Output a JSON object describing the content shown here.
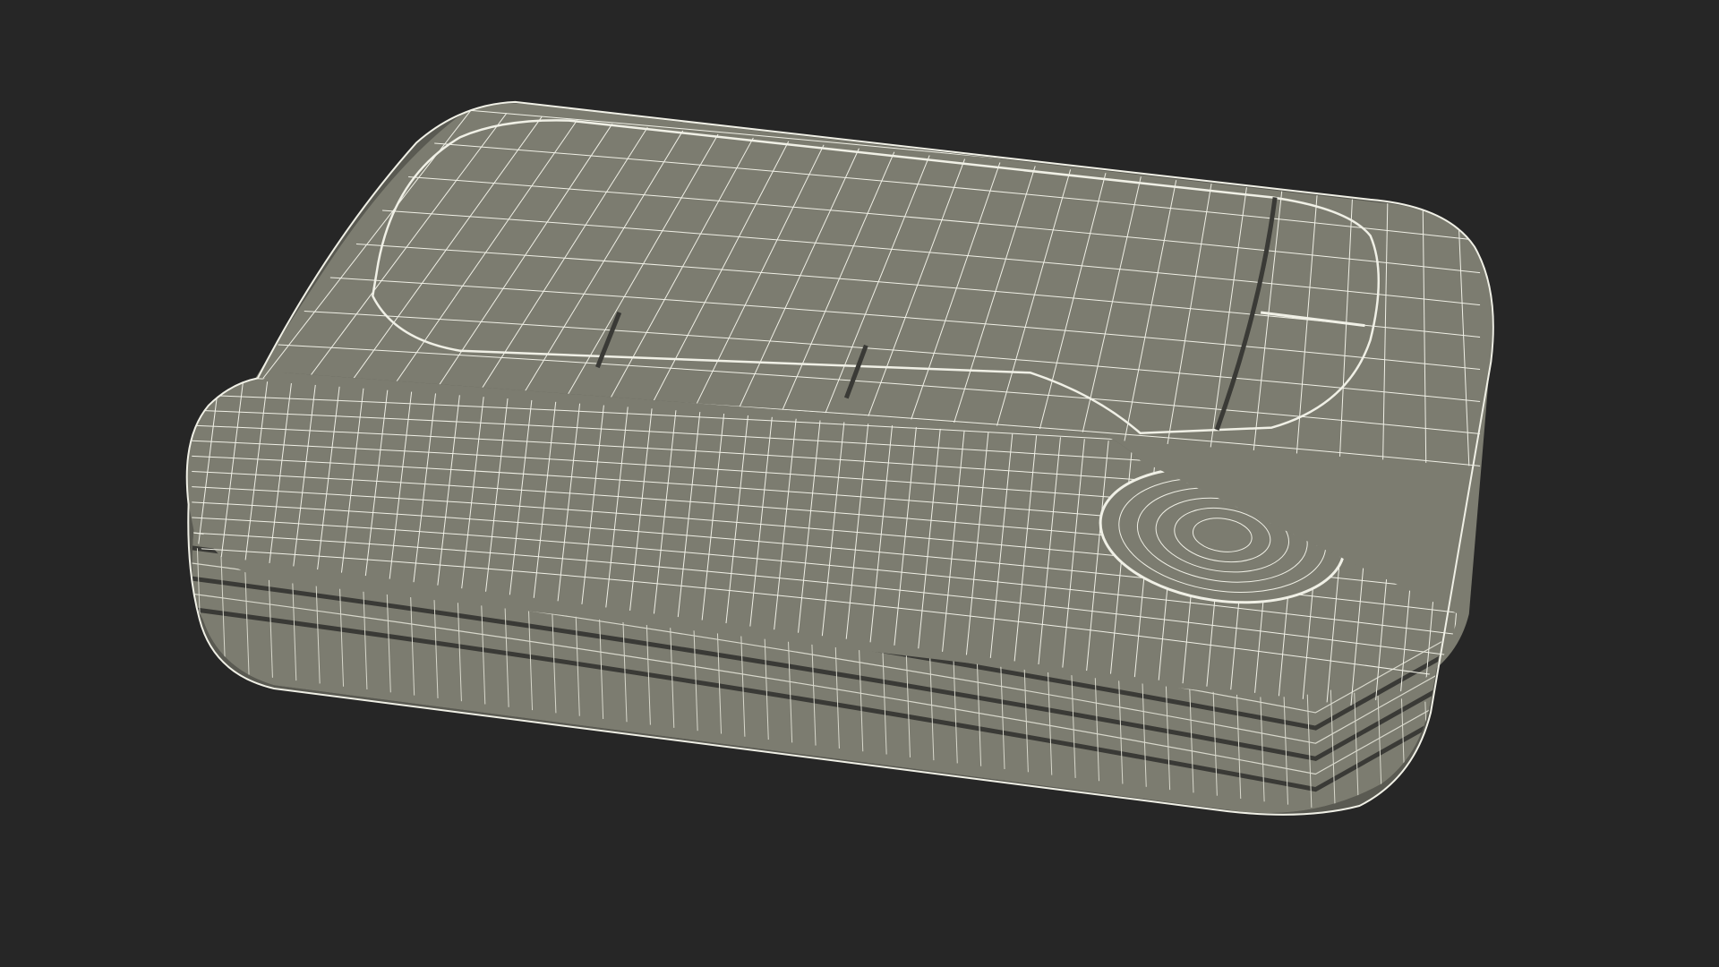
{
  "scene": {
    "subject": "wireframe-3d-model",
    "colors": {
      "background": "#262626",
      "surface": "#7c7c70",
      "surface_dark": "#5a5a52",
      "surface_shadow": "#4a4a44",
      "groove": "#3a3a36",
      "wire": "#f0f0e6",
      "wire_soft": "#d8d8cc"
    },
    "render": {
      "top_wire_count_u": 28,
      "top_wire_count_v": 8,
      "front_wire_count": 52,
      "side_band_count": 6
    }
  }
}
